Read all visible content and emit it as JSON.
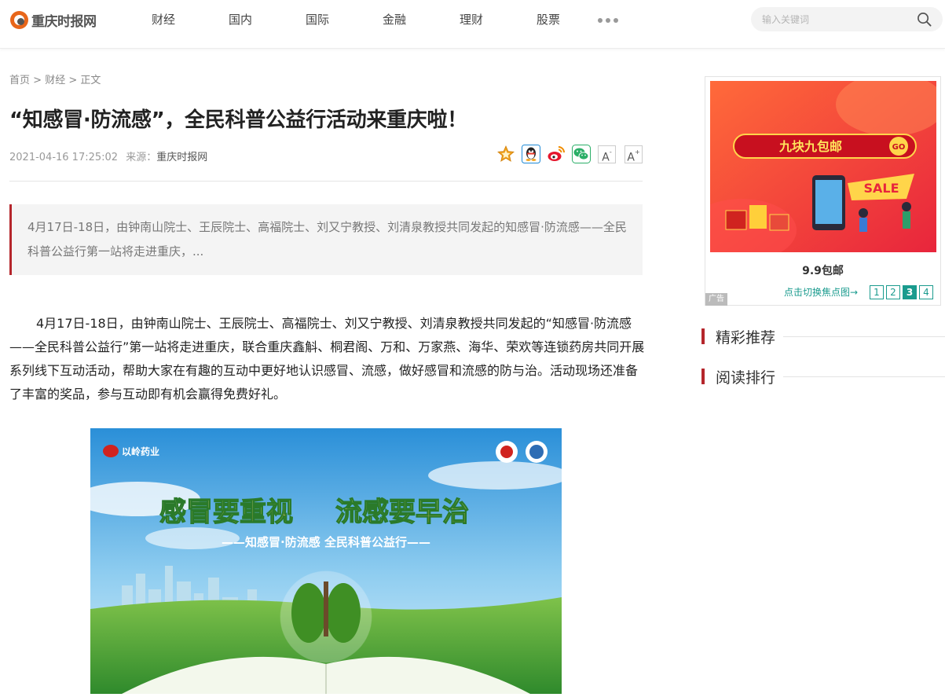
{
  "site": {
    "logo_text": "重庆时报网"
  },
  "nav": {
    "items": [
      "财经",
      "国内",
      "国际",
      "金融",
      "理财",
      "股票"
    ]
  },
  "search": {
    "placeholder": "输入关键词"
  },
  "breadcrumb": {
    "home": "首页",
    "sep1": " > ",
    "category": "财经",
    "sep2": " > ",
    "current": "正文"
  },
  "article": {
    "title": "“知感冒·防流感”，全民科普公益行活动来重庆啦！",
    "datetime": "2021-04-16 17:25:02",
    "source_label": "来源：",
    "source_name": "重庆时报网",
    "summary": "4月17日-18日，由钟南山院士、王辰院士、高福院士、刘又宁教授、刘清泉教授共同发起的知感冒·防流感——全民科普公益行第一站将走进重庆，...",
    "body": "4月17日-18日，由钟南山院士、王辰院士、高福院士、刘又宁教授、刘清泉教授共同发起的“知感冒·防流感——全民科普公益行”第一站将走进重庆，联合重庆鑫斛、桐君阁、万和、万家燕、海华、荣欢等连锁药房共同开展系列线下互动活动，帮助大家在有趣的互动中更好地认识感冒、流感，做好感冒和流感的防与治。活动现场还准备了丰富的奖品，参与互动即有机会赢得免费好礼。",
    "image": {
      "headline_left": "感冒要重视",
      "headline_right": "流感要早治",
      "subline": "——知感冒·防流感 全民科普公益行——",
      "brand": "以岭药业"
    }
  },
  "share": {
    "icons": [
      "favorite-star-icon",
      "qq-icon",
      "weibo-icon",
      "wechat-icon"
    ],
    "font_smaller": "A",
    "font_larger": "A",
    "font_smaller_mark": "-",
    "font_larger_mark": "+"
  },
  "sidebar": {
    "ad": {
      "banner_text": "九块九包邮",
      "banner_go": "GO",
      "sale_text": "SALE",
      "caption": "9.9包邮",
      "switch_hint": "点击切换焦点图→",
      "pages": [
        "1",
        "2",
        "3",
        "4"
      ],
      "active_page": "3",
      "tag": "广告"
    },
    "sections": [
      "精彩推荐",
      "阅读排行"
    ]
  },
  "colors": {
    "accent_red": "#b5262c",
    "teal": "#1a9b8e",
    "logo_orange": "#e8661a"
  }
}
